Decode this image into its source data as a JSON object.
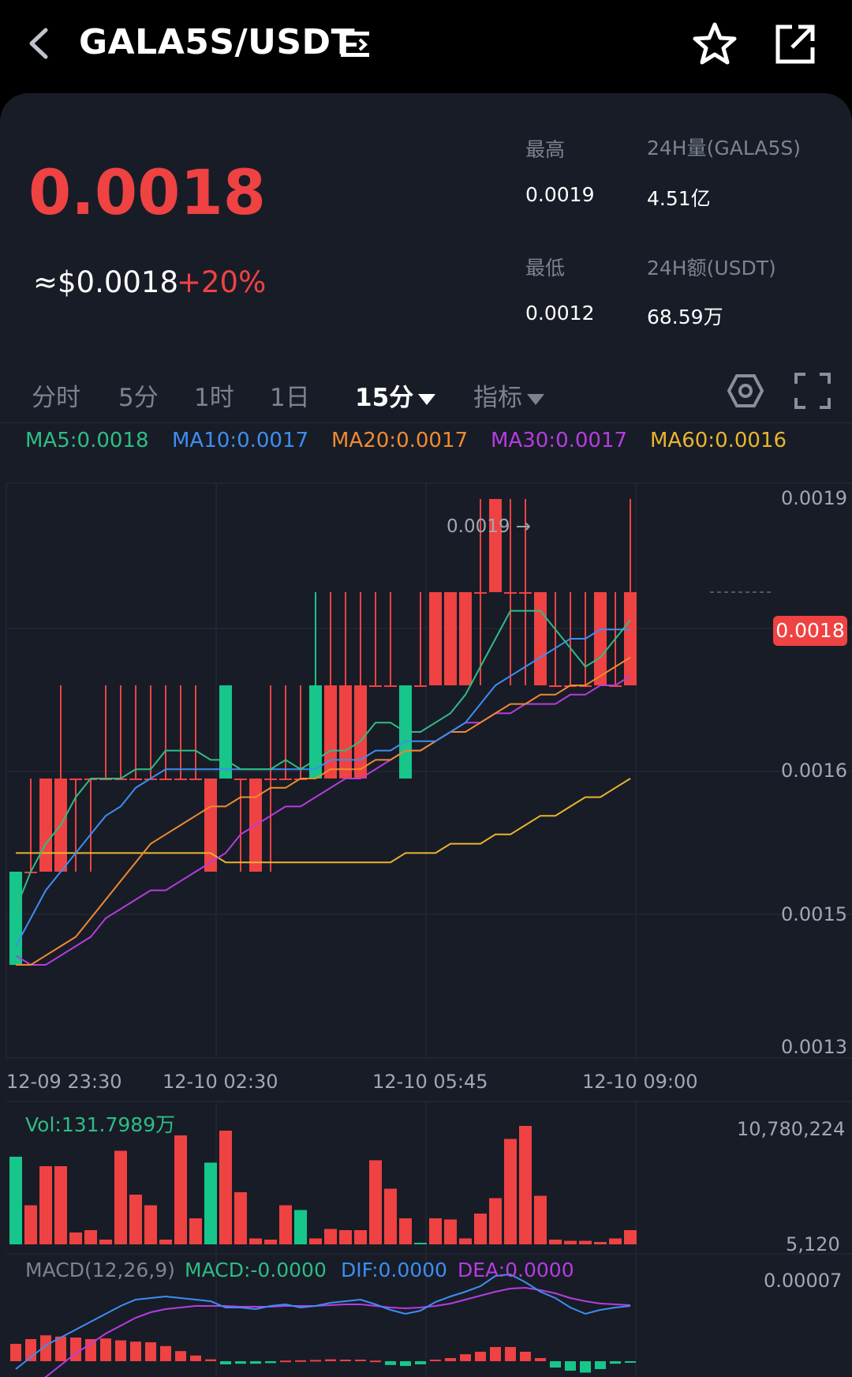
{
  "header": {
    "pair": "GALA5S/USDT"
  },
  "ticker": {
    "price": "0.0018",
    "usd_price": "≈$0.0018",
    "change": "+20%",
    "high_label": "最高",
    "high_value": "0.0019",
    "low_label": "最低",
    "low_value": "0.0012",
    "vol_label": "24H量(GALA5S)",
    "vol_value": "4.51亿",
    "amount_label": "24H额(USDT)",
    "amount_value": "68.59万"
  },
  "timeframes": [
    "分时",
    "5分",
    "1时",
    "1日",
    "15分",
    "指标"
  ],
  "ma_legend": [
    {
      "label": "MA5:0.0018",
      "color": "#2ebd85"
    },
    {
      "label": "MA10:0.0017",
      "color": "#3d8ef0"
    },
    {
      "label": "MA20:0.0017",
      "color": "#f08a30"
    },
    {
      "label": "MA30:0.0017",
      "color": "#b53de0"
    },
    {
      "label": "MA60:0.0016",
      "color": "#e8b52d"
    }
  ],
  "price_axis": [
    "0.0019",
    "0.0016",
    "0.0015",
    "0.0013"
  ],
  "current_price_tag": "0.0018",
  "high_marker": "0.0019 →",
  "time_axis": [
    "12-09 23:30",
    "12-10 02:30",
    "12-10 05:45",
    "12-10 09:00"
  ],
  "volume": {
    "label": "Vol:131.7989万",
    "axis_top": "10,780,224",
    "axis_bottom": "5,120"
  },
  "macd": {
    "title": "MACD(12,26,9)",
    "macd": "MACD:-0.0000",
    "dif": "DIF:0.0000",
    "dea": "DEA:0.0000",
    "axis_top": "0.00007"
  },
  "colors": {
    "up": "#ef4242",
    "down": "#17c68a",
    "ma5": "#2ebd85",
    "ma10": "#3d8ef0",
    "ma20": "#f08a30",
    "ma30": "#b53de0",
    "ma60": "#e8b52d"
  },
  "chart_data": {
    "type": "candlestick",
    "ylim": [
      0.0013,
      0.0019
    ],
    "candles": [
      [
        "G",
        0.0014,
        0.0015,
        0.0014,
        0.0015
      ],
      [
        "R",
        0.0015,
        0.0016,
        0.0015,
        0.0015
      ],
      [
        "R",
        0.0015,
        0.0016,
        0.0015,
        0.0016
      ],
      [
        "R",
        0.0015,
        0.0017,
        0.0015,
        0.0016
      ],
      [
        "R",
        0.0016,
        0.0016,
        0.0015,
        0.0016
      ],
      [
        "R",
        0.0016,
        0.0016,
        0.0015,
        0.0016
      ],
      [
        "R",
        0.0016,
        0.0017,
        0.0016,
        0.0016
      ],
      [
        "R",
        0.0016,
        0.0017,
        0.0016,
        0.0016
      ],
      [
        "R",
        0.0016,
        0.0017,
        0.0016,
        0.0016
      ],
      [
        "R",
        0.0016,
        0.0017,
        0.0016,
        0.0016
      ],
      [
        "R",
        0.0016,
        0.0017,
        0.0016,
        0.0016
      ],
      [
        "R",
        0.0016,
        0.0017,
        0.0016,
        0.0016
      ],
      [
        "R",
        0.0016,
        0.0017,
        0.0016,
        0.0016
      ],
      [
        "R",
        0.0016,
        0.0016,
        0.0015,
        0.0015
      ],
      [
        "G",
        0.0016,
        0.0017,
        0.0016,
        0.0017
      ],
      [
        "R",
        0.0016,
        0.0016,
        0.0015,
        0.0016
      ],
      [
        "R",
        0.0016,
        0.0016,
        0.0015,
        0.0015
      ],
      [
        "R",
        0.0016,
        0.0017,
        0.0015,
        0.0016
      ],
      [
        "R",
        0.0016,
        0.0017,
        0.0016,
        0.0016
      ],
      [
        "R",
        0.0016,
        0.0017,
        0.0016,
        0.0016
      ],
      [
        "G",
        0.0016,
        0.0018,
        0.0016,
        0.0017
      ],
      [
        "R",
        0.0017,
        0.0018,
        0.0016,
        0.0016
      ],
      [
        "R",
        0.0017,
        0.0018,
        0.0016,
        0.0016
      ],
      [
        "R",
        0.0017,
        0.0018,
        0.0016,
        0.0016
      ],
      [
        "R",
        0.0017,
        0.0018,
        0.0017,
        0.0017
      ],
      [
        "R",
        0.0017,
        0.0018,
        0.0017,
        0.0017
      ],
      [
        "G",
        0.0016,
        0.0017,
        0.0016,
        0.0017
      ],
      [
        "R",
        0.0017,
        0.0018,
        0.0017,
        0.0017
      ],
      [
        "R",
        0.0018,
        0.0018,
        0.0017,
        0.0017
      ],
      [
        "R",
        0.0018,
        0.0018,
        0.0017,
        0.0017
      ],
      [
        "R",
        0.0018,
        0.0018,
        0.0017,
        0.0017
      ],
      [
        "R",
        0.0018,
        0.0019,
        0.0017,
        0.0018
      ],
      [
        "R",
        0.0019,
        0.0019,
        0.0018,
        0.0018
      ],
      [
        "R",
        0.0018,
        0.0019,
        0.0017,
        0.0018
      ],
      [
        "R",
        0.0018,
        0.0019,
        0.0017,
        0.0018
      ],
      [
        "R",
        0.0018,
        0.0018,
        0.0017,
        0.0017
      ],
      [
        "R",
        0.0017,
        0.0018,
        0.0017,
        0.0017
      ],
      [
        "R",
        0.0017,
        0.0018,
        0.0017,
        0.0017
      ],
      [
        "R",
        0.0017,
        0.0018,
        0.0017,
        0.0017
      ],
      [
        "R",
        0.0018,
        0.0018,
        0.0017,
        0.0017
      ],
      [
        "R",
        0.0017,
        0.0018,
        0.0017,
        0.0017
      ],
      [
        "R",
        0.0017,
        0.0019,
        0.0017,
        0.0018
      ]
    ],
    "ma5": [
      0.00146,
      0.0015,
      0.00153,
      0.00155,
      0.00158,
      0.0016,
      0.0016,
      0.0016,
      0.00161,
      0.00161,
      0.00163,
      0.00163,
      0.00163,
      0.00162,
      0.00162,
      0.00161,
      0.00161,
      0.00161,
      0.00162,
      0.00161,
      0.00162,
      0.00163,
      0.00163,
      0.00164,
      0.00166,
      0.00166,
      0.00165,
      0.00165,
      0.00166,
      0.00167,
      0.00169,
      0.00172,
      0.00175,
      0.00178,
      0.00178,
      0.00178,
      0.00176,
      0.00174,
      0.00172,
      0.00173,
      0.00175,
      0.00177
    ],
    "ma10": [
      0.00142,
      0.00145,
      0.00148,
      0.0015,
      0.00152,
      0.00154,
      0.00156,
      0.00157,
      0.00159,
      0.0016,
      0.00161,
      0.00161,
      0.00161,
      0.00161,
      0.00161,
      0.00161,
      0.00161,
      0.00161,
      0.00161,
      0.00161,
      0.00161,
      0.00162,
      0.00162,
      0.00162,
      0.00163,
      0.00163,
      0.00164,
      0.00164,
      0.00164,
      0.00165,
      0.00166,
      0.00168,
      0.0017,
      0.00171,
      0.00172,
      0.00173,
      0.00174,
      0.00175,
      0.00175,
      0.00176,
      0.00176,
      0.00176
    ],
    "ma20": [
      0.0014,
      0.0014,
      0.00141,
      0.00142,
      0.00143,
      0.00145,
      0.00147,
      0.00149,
      0.00151,
      0.00153,
      0.00154,
      0.00155,
      0.00156,
      0.00157,
      0.00157,
      0.00158,
      0.00158,
      0.00159,
      0.00159,
      0.0016,
      0.0016,
      0.00161,
      0.00161,
      0.00161,
      0.00162,
      0.00162,
      0.00163,
      0.00163,
      0.00164,
      0.00165,
      0.00165,
      0.00166,
      0.00167,
      0.00168,
      0.00168,
      0.00169,
      0.00169,
      0.0017,
      0.0017,
      0.00171,
      0.00172,
      0.00173
    ],
    "ma30": [
      0.00141,
      0.0014,
      0.0014,
      0.00141,
      0.00142,
      0.00143,
      0.00145,
      0.00146,
      0.00147,
      0.00148,
      0.00148,
      0.00149,
      0.0015,
      0.00151,
      0.00152,
      0.00154,
      0.00155,
      0.00156,
      0.00157,
      0.00157,
      0.00158,
      0.00159,
      0.0016,
      0.0016,
      0.00161,
      0.00162,
      0.00163,
      0.00163,
      0.00164,
      0.00165,
      0.00166,
      0.00166,
      0.00167,
      0.00167,
      0.00168,
      0.00168,
      0.00168,
      0.00169,
      0.00169,
      0.0017,
      0.0017,
      0.00171
    ],
    "ma60": [
      0.00152,
      0.00152,
      0.00152,
      0.00152,
      0.00152,
      0.00152,
      0.00152,
      0.00152,
      0.00152,
      0.00152,
      0.00152,
      0.00152,
      0.00152,
      0.00152,
      0.00151,
      0.00151,
      0.00151,
      0.00151,
      0.00151,
      0.00151,
      0.00151,
      0.00151,
      0.00151,
      0.00151,
      0.00151,
      0.00151,
      0.00152,
      0.00152,
      0.00152,
      0.00153,
      0.00153,
      0.00153,
      0.00154,
      0.00154,
      0.00155,
      0.00156,
      0.00156,
      0.00157,
      0.00158,
      0.00158,
      0.00159,
      0.0016
    ],
    "volume": [
      [
        "G",
        0.74
      ],
      [
        "R",
        0.33
      ],
      [
        "R",
        0.66
      ],
      [
        "R",
        0.66
      ],
      [
        "R",
        0.1
      ],
      [
        "R",
        0.12
      ],
      [
        "R",
        0.04
      ],
      [
        "R",
        0.79
      ],
      [
        "R",
        0.42
      ],
      [
        "R",
        0.33
      ],
      [
        "R",
        0.04
      ],
      [
        "R",
        0.92
      ],
      [
        "R",
        0.22
      ],
      [
        "G",
        0.69
      ],
      [
        "R",
        0.96
      ],
      [
        "R",
        0.44
      ],
      [
        "R",
        0.05
      ],
      [
        "R",
        0.04
      ],
      [
        "R",
        0.33
      ],
      [
        "G",
        0.29
      ],
      [
        "R",
        0.05
      ],
      [
        "R",
        0.13
      ],
      [
        "R",
        0.12
      ],
      [
        "R",
        0.12
      ],
      [
        "R",
        0.71
      ],
      [
        "R",
        0.47
      ],
      [
        "R",
        0.22
      ],
      [
        "G",
        0.01
      ],
      [
        "R",
        0.22
      ],
      [
        "R",
        0.21
      ],
      [
        "R",
        0.05
      ],
      [
        "R",
        0.26
      ],
      [
        "R",
        0.39
      ],
      [
        "R",
        0.89
      ],
      [
        "R",
        1.0
      ],
      [
        "R",
        0.41
      ],
      [
        "R",
        0.04
      ],
      [
        "R",
        0.03
      ],
      [
        "R",
        0.03
      ],
      [
        "R",
        0.02
      ],
      [
        "R",
        0.05
      ],
      [
        "R",
        0.12
      ]
    ],
    "macd_hist": [
      0.55,
      0.7,
      0.82,
      0.78,
      0.75,
      0.7,
      0.72,
      0.66,
      0.62,
      0.6,
      0.48,
      0.32,
      0.18,
      0.06,
      -0.1,
      -0.08,
      -0.08,
      -0.06,
      0.02,
      0.03,
      0.04,
      0.06,
      0.05,
      0.05,
      0.02,
      -0.12,
      -0.15,
      -0.1,
      0.05,
      0.1,
      0.22,
      0.3,
      0.45,
      0.45,
      0.3,
      0.1,
      -0.2,
      -0.3,
      -0.36,
      -0.25,
      -0.08,
      -0.05
    ],
    "dif": [
      -0.6,
      -0.45,
      -0.3,
      -0.2,
      -0.1,
      0.0,
      0.1,
      0.2,
      0.28,
      0.3,
      0.32,
      0.3,
      0.28,
      0.26,
      0.18,
      0.18,
      0.16,
      0.2,
      0.22,
      0.18,
      0.2,
      0.24,
      0.26,
      0.28,
      0.22,
      0.15,
      0.1,
      0.14,
      0.25,
      0.32,
      0.38,
      0.45,
      0.58,
      0.6,
      0.5,
      0.38,
      0.3,
      0.18,
      0.1,
      0.15,
      0.18,
      0.2
    ],
    "dea": [
      -0.9,
      -0.8,
      -0.7,
      -0.55,
      -0.4,
      -0.28,
      -0.15,
      -0.05,
      0.05,
      0.12,
      0.16,
      0.18,
      0.2,
      0.2,
      0.2,
      0.19,
      0.19,
      0.19,
      0.2,
      0.2,
      0.2,
      0.21,
      0.22,
      0.22,
      0.2,
      0.18,
      0.17,
      0.18,
      0.2,
      0.23,
      0.28,
      0.33,
      0.38,
      0.42,
      0.43,
      0.4,
      0.36,
      0.3,
      0.26,
      0.23,
      0.22,
      0.21
    ]
  }
}
